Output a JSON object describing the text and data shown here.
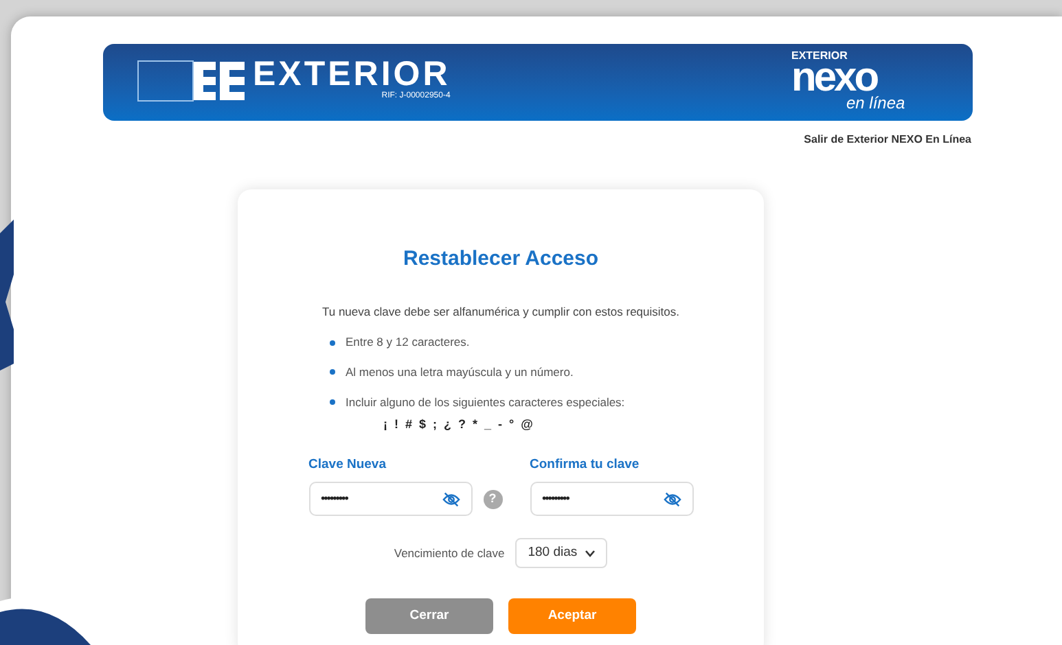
{
  "header": {
    "bank_logo": {
      "text": "EXTERIOR",
      "rif": "RIF: J-00002950-4"
    },
    "nexo_logo": {
      "top": "EXTERIOR",
      "main": "nexo",
      "sub": "en línea"
    }
  },
  "exit_link": "Salir de Exterior NEXO En Línea",
  "form": {
    "title": "Restablecer Acceso",
    "intro": "Tu nueva clave debe ser alfanumérica y cumplir con estos requisitos.",
    "requirements": [
      "Entre 8 y 12 caracteres.",
      "Al menos una letra mayúscula y un número.",
      "Incluir alguno de los siguientes caracteres especiales:"
    ],
    "special_characters": "¡ ! # $ ; ¿ ? * _ - ° @",
    "fields": [
      {
        "label": "Clave Nueva",
        "value": "•••••••••",
        "help": "?"
      },
      {
        "label": "Confirma tu clave",
        "value": "•••••••••"
      }
    ],
    "expiry": {
      "label": "Vencimiento de clave",
      "value": "180 dias"
    },
    "buttons": [
      {
        "label": "Cerrar",
        "disabled": true
      },
      {
        "label": "Aceptar",
        "disabled": false
      }
    ]
  }
}
